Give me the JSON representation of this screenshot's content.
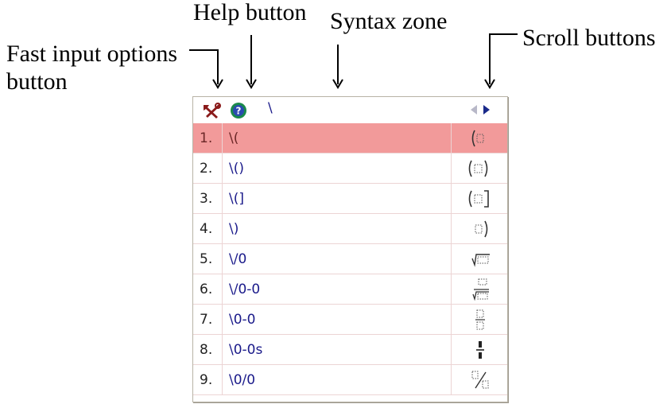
{
  "annotations": {
    "fast_input": "Fast input options",
    "fast_input_line2": "button",
    "help": "Help button",
    "syntax": "Syntax zone",
    "scroll": "Scroll buttons"
  },
  "toolbar": {
    "fast_input_icon": "tools-icon",
    "help_icon": "help-icon",
    "syntax_text": "\\",
    "scroll_left_icon": "triangle-left-icon",
    "scroll_right_icon": "triangle-right-icon"
  },
  "colors": {
    "selected_row": "#f29a9a",
    "command_text": "#1a1a8a",
    "help_icon": "#1a8a4a"
  },
  "rows": [
    {
      "num": "1.",
      "cmd": "\\(",
      "sym": "paren-open",
      "selected": true
    },
    {
      "num": "2.",
      "cmd": "\\()",
      "sym": "paren-pair",
      "selected": false
    },
    {
      "num": "3.",
      "cmd": "\\(]",
      "sym": "paren-bracket",
      "selected": false
    },
    {
      "num": "4.",
      "cmd": "\\)",
      "sym": "paren-close",
      "selected": false
    },
    {
      "num": "5.",
      "cmd": "\\/0",
      "sym": "sqrt",
      "selected": false
    },
    {
      "num": "6.",
      "cmd": "\\/0-0",
      "sym": "nth-root",
      "selected": false
    },
    {
      "num": "7.",
      "cmd": "\\0-0",
      "sym": "fraction",
      "selected": false
    },
    {
      "num": "8.",
      "cmd": "\\0-0s",
      "sym": "small-fraction",
      "selected": false
    },
    {
      "num": "9.",
      "cmd": "\\0/0",
      "sym": "slash-fraction",
      "selected": false
    }
  ]
}
